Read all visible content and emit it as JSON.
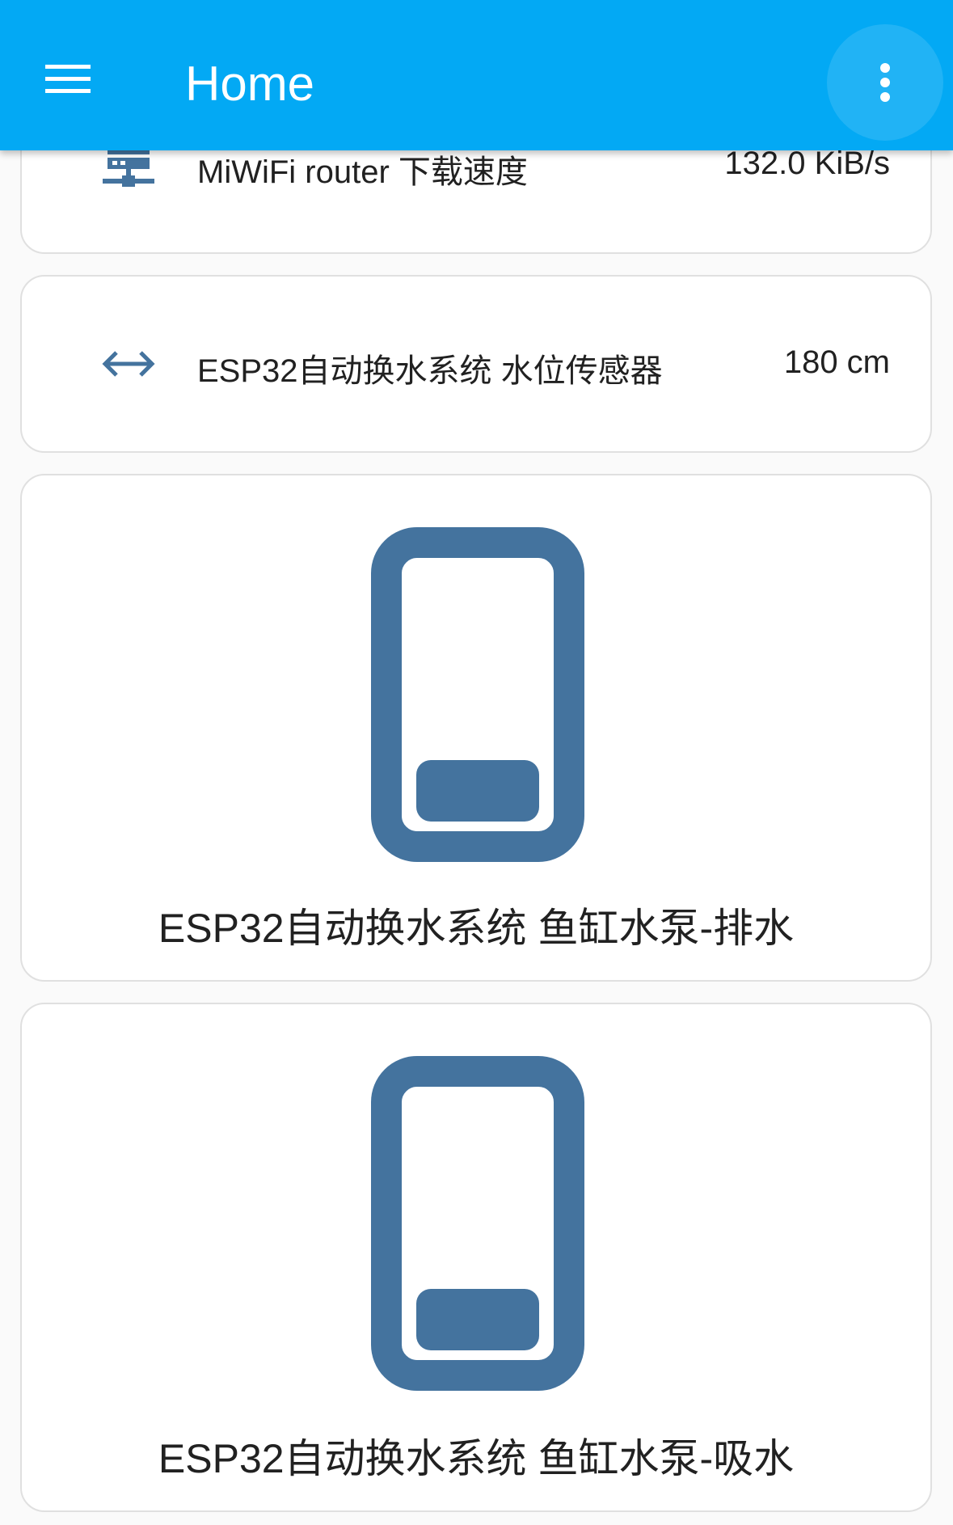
{
  "header": {
    "title": "Home",
    "background_color": "#03a9f4",
    "menu_icon": "hamburger-menu-icon",
    "overflow_icon": "dots-vertical-icon"
  },
  "entities": [
    {
      "name": "MiWiFi router 下载速度",
      "value": "132.0 KiB/s",
      "icon": "server-network-icon"
    },
    {
      "name": "ESP32自动换水系统 水位传感器",
      "value": "180 cm",
      "icon": "arrow-left-right-icon"
    }
  ],
  "buttons": [
    {
      "label": "ESP32自动换水系统 鱼缸水泵-排水",
      "icon": "cellphone-icon"
    },
    {
      "label": "ESP32自动换水系统 鱼缸水泵-吸水",
      "icon": "cellphone-icon"
    }
  ],
  "colors": {
    "icon": "#44739e",
    "card_border": "#e0e0e0",
    "page_background": "#fafafa"
  }
}
